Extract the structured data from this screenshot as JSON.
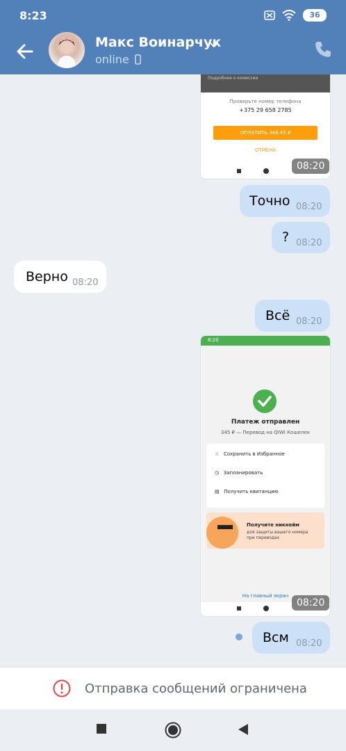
{
  "status_bar": {
    "time": "8:23",
    "battery": "36"
  },
  "header": {
    "contact_name": "Макс Воинарчук",
    "status": "online"
  },
  "image1": {
    "caption_top": "Подробнее о комиссии",
    "prompt": "Проверьте номер телефона",
    "phone": "+375 29 658 2785",
    "pay_button": "ОПЛАТИТЬ 348.45 ₽",
    "cancel": "ОТМЕНА",
    "time": "08:20"
  },
  "messages": [
    {
      "text": "Точно",
      "time": "08:20"
    },
    {
      "text": "?",
      "time": "08:20"
    },
    {
      "text": "Верно",
      "time": "08:20"
    },
    {
      "text": "Всё",
      "time": "08:20"
    },
    {
      "text": "Всм",
      "time": "08:20"
    }
  ],
  "image2": {
    "status_time": "8:20",
    "title": "Платеж отправлен",
    "subtitle": "345 ₽ — Перевод на QIWI Кошелек",
    "options": [
      "Сохранить в Избранное",
      "Запланировать",
      "Получить квитанцию"
    ],
    "promo_title": "Получите никнейм",
    "promo_text": "для защиты вашего номера при переводах",
    "home_link": "На главный экран",
    "time": "08:20"
  },
  "restriction": {
    "text": "Отправка сообщений ограничена"
  },
  "colors": {
    "header": "#5181b8",
    "outgoing": "#cce0f7",
    "incoming": "#ffffff",
    "qiwi_green": "#4caf50",
    "pay_orange": "#ff9e0d"
  }
}
